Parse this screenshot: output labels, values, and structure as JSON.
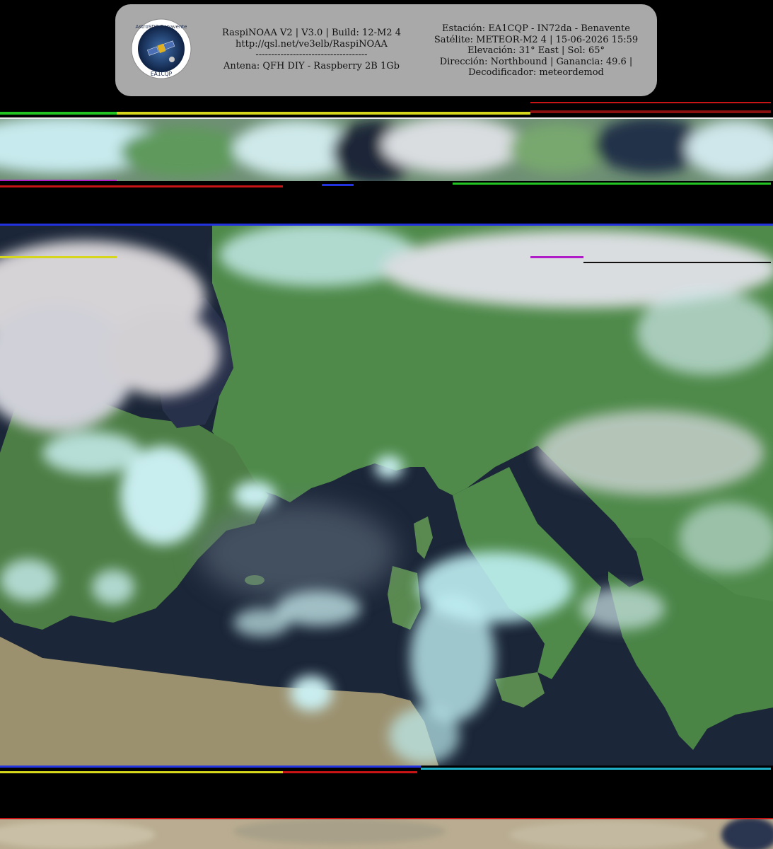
{
  "header": {
    "logo": {
      "icon": "satellite-logo-icon",
      "ring_text_top": "AstroSDR Benavente",
      "ring_text_bottom": "EA1CQP"
    },
    "software_line": "RaspiNOAA V2 | V3.0 | Build: 12-M2 4",
    "url_line": "http://qsl.net/ve3elb/RaspiNOAA",
    "separator_line": "------------------------------------",
    "antenna_line": "Antena: QFH DIY - Raspberry 2B 1Gb",
    "station_line": "Estación: EA1CQP - IN72da - Benavente",
    "satellite_line": "Satélite: METEOR-M2 4 | 15-06-2026 15:59",
    "elevation_line": "Elevación: 31° East | Sol: 65°",
    "direction_line": "Dirección: Northbound | Ganancia: 49.6 |",
    "decoder_line": "Decodificador: meteordemod"
  },
  "imagery": {
    "colors": {
      "sea": "#1b2638",
      "land": "#4f8a4a",
      "arid": "#a89a78",
      "cloud": "#c9eef0",
      "cloud_gray": "#d6d3d6",
      "noise_red": "#c81414",
      "noise_green": "#22c422",
      "noise_blue": "#2233dd",
      "noise_yellow": "#d6d61c",
      "noise_magenta": "#b01cc8"
    }
  }
}
